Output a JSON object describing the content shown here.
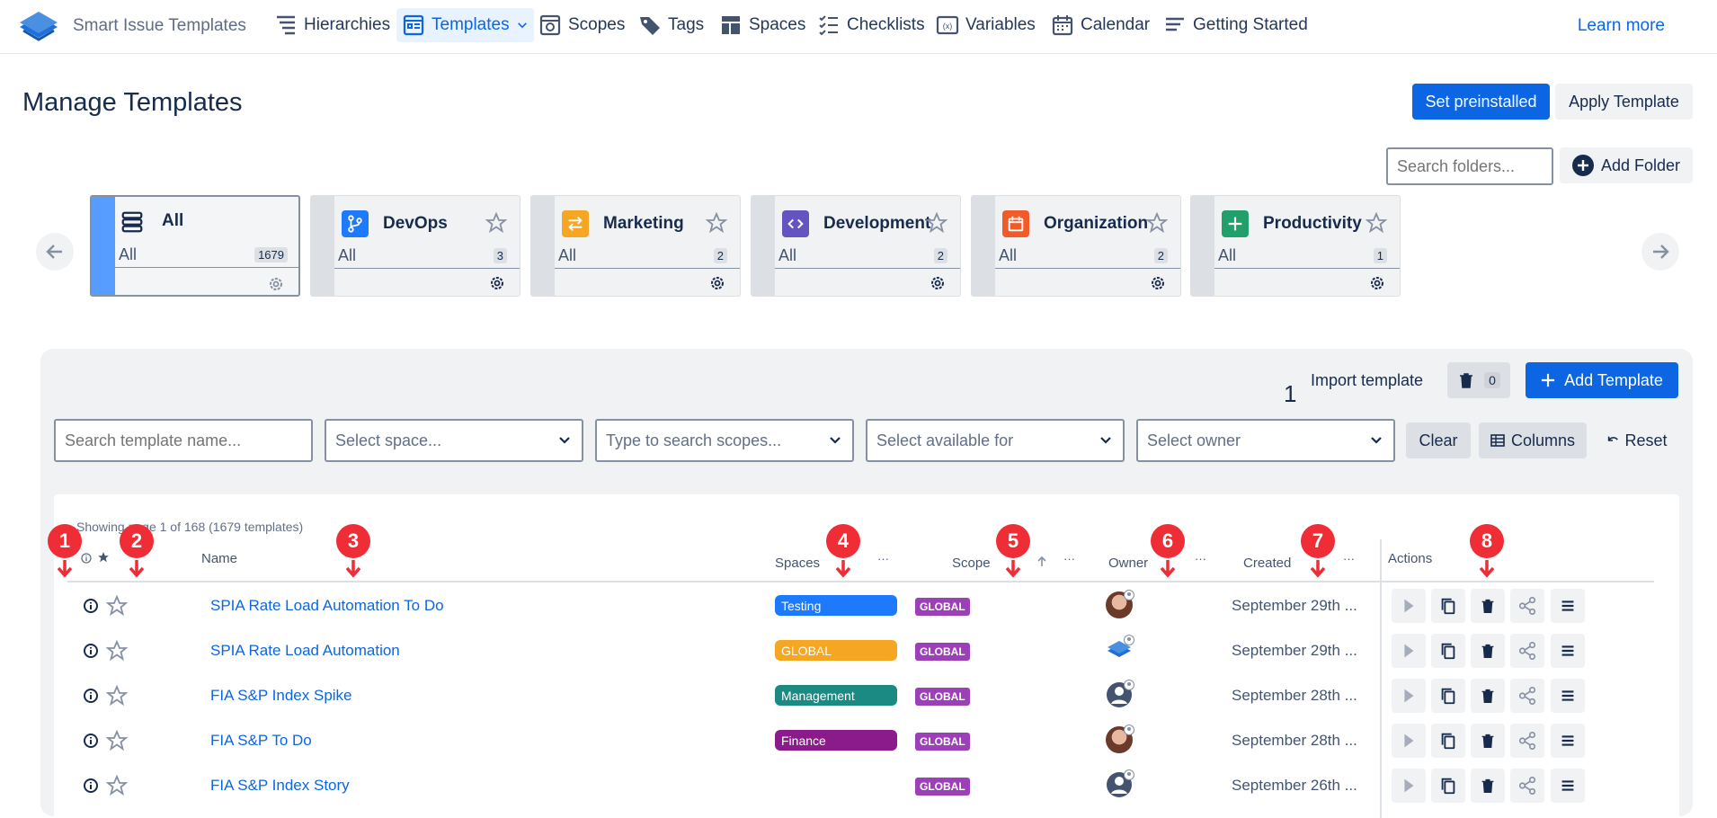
{
  "app": {
    "name": "Smart Issue Templates",
    "learn_more": "Learn more"
  },
  "nav": [
    {
      "label": "Hierarchies",
      "icon": "hierarchy-icon"
    },
    {
      "label": "Templates",
      "icon": "templates-icon",
      "active": true
    },
    {
      "label": "Scopes",
      "icon": "scopes-icon"
    },
    {
      "label": "Tags",
      "icon": "tags-icon"
    },
    {
      "label": "Spaces",
      "icon": "spaces-icon"
    },
    {
      "label": "Checklists",
      "icon": "checklist-icon"
    },
    {
      "label": "Variables",
      "icon": "variables-icon"
    },
    {
      "label": "Calendar",
      "icon": "calendar-icon"
    },
    {
      "label": "Getting Started",
      "icon": "getting-started-icon"
    }
  ],
  "page": {
    "title": "Manage Templates",
    "set_preinstalled": "Set preinstalled",
    "apply_template": "Apply Template"
  },
  "folders_search": {
    "placeholder": "Search folders...",
    "add_folder": "Add Folder"
  },
  "folders": [
    {
      "name": "All",
      "all": "All",
      "count": "1679",
      "color": "#f1f2f4"
    },
    {
      "name": "DevOps",
      "all": "All",
      "count": "3",
      "color": "#1d7afc"
    },
    {
      "name": "Marketing",
      "all": "All",
      "count": "2",
      "color": "#f5a623"
    },
    {
      "name": "Development",
      "all": "All",
      "count": "2",
      "color": "#6554c0"
    },
    {
      "name": "Organization",
      "all": "All",
      "count": "2",
      "color": "#f15b2a"
    },
    {
      "name": "Productivity",
      "all": "All",
      "count": "1",
      "color": "#22a06b"
    }
  ],
  "toolbar": {
    "badge": "1",
    "import": "Import template",
    "trash_count": "0",
    "add_template": "Add Template"
  },
  "filters": {
    "name_placeholder": "Search template name...",
    "space_placeholder": "Select space...",
    "scope_placeholder": "Type to search scopes...",
    "available_placeholder": "Select available for",
    "owner_placeholder": "Select owner",
    "clear": "Clear",
    "columns": "Columns",
    "reset": "Reset"
  },
  "table": {
    "showing": "Showing page 1 of 168 (1679 templates)",
    "headers": {
      "name": "Name",
      "spaces": "Spaces",
      "scope": "Scope",
      "owner": "Owner",
      "created": "Created",
      "actions": "Actions",
      "more": "···"
    },
    "rows": [
      {
        "name": "SPIA Rate Load Automation To Do",
        "space": "Testing",
        "space_color": "#1d7afc",
        "scope": "GLOBAL",
        "owner": "photo",
        "created": "September 29th ..."
      },
      {
        "name": "SPIA Rate Load Automation",
        "space": "GLOBAL",
        "space_color": "#f5a623",
        "scope": "GLOBAL",
        "owner": "logo",
        "created": "September 29th ..."
      },
      {
        "name": "FIA S&P Index Spike",
        "space": "Management",
        "space_color": "#1b8a82",
        "scope": "GLOBAL",
        "owner": "generic",
        "created": "September 28th ..."
      },
      {
        "name": "FIA S&P To Do",
        "space": "Finance",
        "space_color": "#8b1a8b",
        "scope": "GLOBAL",
        "owner": "photo",
        "created": "September 28th ..."
      },
      {
        "name": "FIA S&P Index Story",
        "space": "",
        "space_color": "",
        "scope": "GLOBAL",
        "owner": "generic",
        "created": "September 26th ..."
      }
    ]
  },
  "markers": [
    "1",
    "2",
    "3",
    "4",
    "5",
    "6",
    "7",
    "8"
  ]
}
